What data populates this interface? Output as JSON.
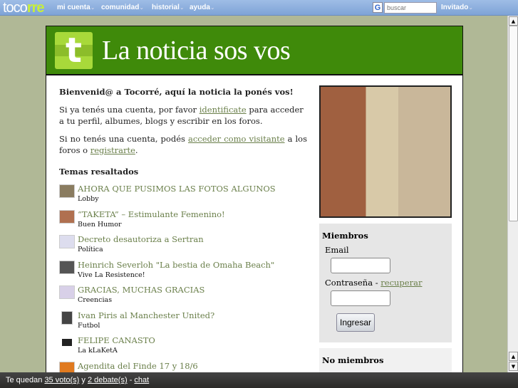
{
  "topbar": {
    "logo_a": "toco",
    "logo_b": "rre",
    "nav": [
      "mi cuenta",
      "comunidad",
      "historial",
      "ayuda"
    ],
    "search_placeholder": "buscar",
    "user": "Invitado"
  },
  "header": {
    "icon_letter": "t",
    "title": "La noticia sos vos"
  },
  "welcome": {
    "heading": "Bienvenid@ a Tocorré, aquí la noticia la ponés vos!",
    "p1_a": "Si ya tenés una cuenta, por favor ",
    "p1_link": "identificate",
    "p1_b": " para acceder a tu perfil, albumes, blogs y escribir en los foros.",
    "p2_a": "Si no tenés una cuenta, podés ",
    "p2_link": "acceder como visitante",
    "p2_b": " a los foros o ",
    "p2_link2": "registrarte",
    "p2_c": "."
  },
  "topics_heading": "Temas resaltados",
  "topics": [
    {
      "title": "AHORA QUE PUSIMOS LAS FOTOS ALGUNOS",
      "cat": "Lobby"
    },
    {
      "title": "“TAKETA” – Estimulante Femenino!",
      "cat": "Buen Humor"
    },
    {
      "title": "Decreto desautoriza a Sertran",
      "cat": "Política"
    },
    {
      "title": "Heinrich Severloh \"La bestia de Omaha Beach\"",
      "cat": "Vive La Resistence!"
    },
    {
      "title": "GRACIAS, MUCHAS GRACIAS",
      "cat": "Creencias"
    },
    {
      "title": "Ivan Piris al Manchester United?",
      "cat": "Futbol"
    },
    {
      "title": "FELIPE CANASTO",
      "cat": "La kLaKetA"
    },
    {
      "title": "Agendita del Finde 17 y 18/6",
      "cat": ""
    }
  ],
  "members": {
    "heading": "Miembros",
    "email_label": "Email",
    "password_label": "Contraseña - ",
    "recover_link": "recuperar",
    "submit": "Ingresar"
  },
  "non_members": {
    "heading": "No miembros"
  },
  "bottombar": {
    "a": "Te quedan ",
    "votes": "35 voto(s)",
    "b": " y ",
    "debates": "2 debate(s)",
    "c": " - ",
    "chat": "chat"
  }
}
